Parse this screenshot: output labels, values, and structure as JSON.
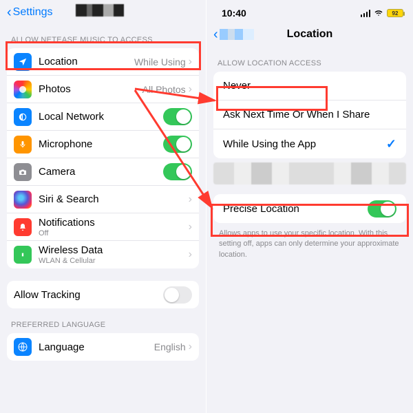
{
  "left": {
    "back_label": "Settings",
    "section_access": "ALLOW NETEASE MUSIC TO ACCESS",
    "rows": {
      "location": {
        "label": "Location",
        "value": "While Using"
      },
      "photos": {
        "label": "Photos",
        "value": "All Photos"
      },
      "local_network": {
        "label": "Local Network"
      },
      "microphone": {
        "label": "Microphone"
      },
      "camera": {
        "label": "Camera"
      },
      "siri": {
        "label": "Siri & Search"
      },
      "notifications": {
        "label": "Notifications",
        "sub": "Off"
      },
      "wireless": {
        "label": "Wireless Data",
        "sub": "WLAN & Cellular"
      }
    },
    "allow_tracking": "Allow Tracking",
    "section_lang": "PREFERRED LANGUAGE",
    "language": {
      "label": "Language",
      "value": "English"
    }
  },
  "right": {
    "time": "10:40",
    "battery": "92",
    "title": "Location",
    "section": "ALLOW LOCATION ACCESS",
    "options": {
      "never": "Never",
      "ask": "Ask Next Time Or When I Share",
      "while": "While Using the App"
    },
    "precise": "Precise Location",
    "footer": "Allows apps to use your specific location. With this setting off, apps can only determine your approximate location."
  }
}
